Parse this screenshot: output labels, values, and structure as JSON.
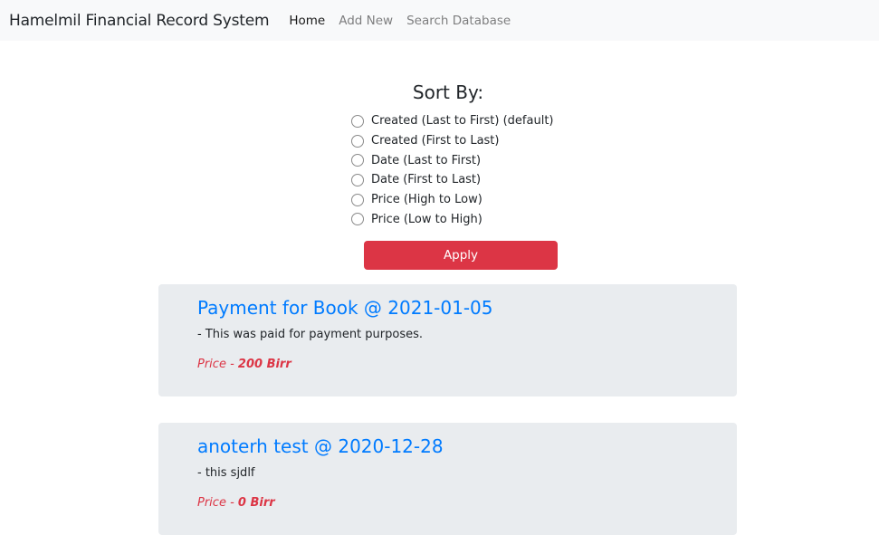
{
  "navbar": {
    "brand": "Hamelmil Financial Record System",
    "links": [
      {
        "label": "Home",
        "active": true
      },
      {
        "label": "Add New"
      },
      {
        "label": "Search Database"
      }
    ]
  },
  "sort": {
    "title": "Sort By:",
    "options": [
      "Created (Last to First) (default)",
      "Created (First to Last)",
      "Date (Last to First)",
      "Date (First to Last)",
      "Price (High to Low)",
      "Price (Low to High)"
    ],
    "apply_label": "Apply"
  },
  "records": [
    {
      "title": "Payment for Book @ 2021-01-05",
      "description": "- This was paid for payment purposes.",
      "price_label": "Price - ",
      "price": "200 Birr"
    },
    {
      "title": "anoterh test @ 2020-12-28",
      "description": "- this sjdlf",
      "price_label": "Price - ",
      "price": "0 Birr"
    }
  ],
  "colors": {
    "primary": "#007bff",
    "danger": "#dc3545",
    "card_bg": "#e9ecef",
    "navbar_bg": "#f8f9fa"
  }
}
